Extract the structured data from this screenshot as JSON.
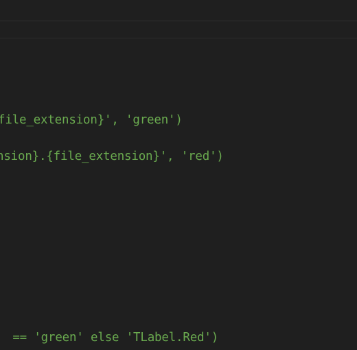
{
  "editor": {
    "colors": {
      "background": "#1f1f1f",
      "string_text": "#6aaa4f",
      "separator": "#2f2f2f"
    },
    "lines": [
      "file_extension}', 'green')",
      "nsion}.{file_extension}', 'red')",
      " == 'green' else 'TLabel.Red')"
    ]
  }
}
